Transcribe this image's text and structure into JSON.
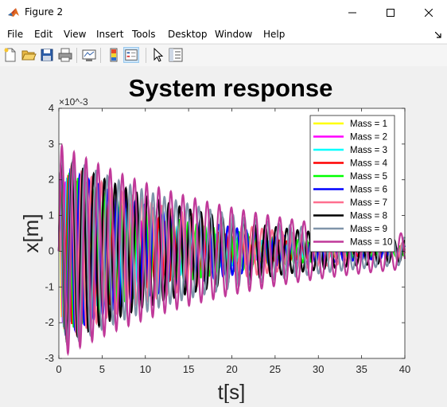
{
  "window": {
    "title": "Figure 2"
  },
  "menu": [
    "File",
    "Edit",
    "View",
    "Insert",
    "Tools",
    "Desktop",
    "Window",
    "Help"
  ],
  "toolbar": [
    "new-figure-icon",
    "open-file-icon",
    "save-icon",
    "print-icon",
    "link-plot-icon",
    "insert-colorbar-icon",
    "insert-legend-icon",
    "edit-plot-icon",
    "property-inspector-icon"
  ],
  "chart_data": {
    "type": "line",
    "title": "System response",
    "xlabel": "t[s]",
    "ylabel": "x[m]",
    "xlim": [
      0,
      40
    ],
    "ylim": [
      -0.003,
      0.004
    ],
    "x_ticks": [
      "0",
      "5",
      "10",
      "15",
      "20",
      "25",
      "30",
      "35",
      "40"
    ],
    "y_ticks": [
      "-3",
      "-2",
      "-1",
      "0",
      "1",
      "2",
      "3",
      "4"
    ],
    "y_exponent": "×10^-3",
    "legend_position": "top-right",
    "series": [
      {
        "name": "Mass = 1",
        "color": "#ffff00",
        "amplitude0": 0.0019,
        "period": 0.45,
        "decay": 0.11
      },
      {
        "name": "Mass = 2",
        "color": "#ff00ff",
        "amplitude0": 0.0021,
        "period": 0.62,
        "decay": 0.095
      },
      {
        "name": "Mass = 3",
        "color": "#00ffff",
        "amplitude0": 0.0022,
        "period": 0.75,
        "decay": 0.085
      },
      {
        "name": "Mass = 4",
        "color": "#ff0000",
        "amplitude0": 0.0023,
        "period": 0.87,
        "decay": 0.08
      },
      {
        "name": "Mass = 5",
        "color": "#00ff00",
        "amplitude0": 0.0024,
        "period": 0.98,
        "decay": 0.072
      },
      {
        "name": "Mass = 6",
        "color": "#0000ff",
        "amplitude0": 0.0025,
        "period": 1.07,
        "decay": 0.066
      },
      {
        "name": "Mass = 7",
        "color": "#ff6f8f",
        "amplitude0": 0.0026,
        "period": 1.16,
        "decay": 0.06
      },
      {
        "name": "Mass = 8",
        "color": "#000000",
        "amplitude0": 0.0027,
        "period": 1.24,
        "decay": 0.055
      },
      {
        "name": "Mass = 9",
        "color": "#8095aa",
        "amplitude0": 0.0028,
        "period": 1.32,
        "decay": 0.05
      },
      {
        "name": "Mass = 10",
        "color": "#c0399a",
        "amplitude0": 0.003,
        "period": 1.4,
        "decay": 0.045
      }
    ]
  }
}
